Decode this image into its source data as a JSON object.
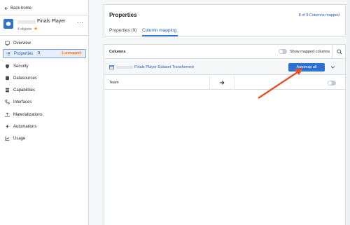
{
  "sidebar": {
    "back_label": "Back home",
    "object": {
      "title": "Finals Player",
      "subtitle": "4 objects"
    },
    "items": [
      {
        "label": "Overview",
        "icon": "overview-icon"
      },
      {
        "label": "Properties",
        "icon": "properties-icon",
        "count": "9",
        "badge": "1 unmapped",
        "active": true
      },
      {
        "label": "Security",
        "icon": "shield-icon"
      },
      {
        "label": "Datasources",
        "icon": "database-icon"
      },
      {
        "label": "Capabilities",
        "icon": "capabilities-icon"
      },
      {
        "label": "Interfaces",
        "icon": "interfaces-icon"
      },
      {
        "label": "Materializations",
        "icon": "upload-icon"
      },
      {
        "label": "Automations",
        "icon": "lightning-icon"
      },
      {
        "label": "Usage",
        "icon": "chart-icon"
      }
    ]
  },
  "header": {
    "title": "Properties",
    "mapped_count": "8 of 9 Columns mapped",
    "tabs": [
      {
        "label": "Properties (9)",
        "active": false
      },
      {
        "label": "Column mapping",
        "active": true
      }
    ]
  },
  "panel": {
    "title": "Columns",
    "show_mapped_label": "Show mapped columns",
    "dataset_name": "Finals Player Dataset Transformed",
    "automap_label": "Automap all",
    "rows": [
      {
        "label": "Team"
      }
    ]
  },
  "colors": {
    "accent": "#2d72d2",
    "annotation_arrow": "#e0502b",
    "unmapped_badge_bg": "#fbe3d6"
  }
}
